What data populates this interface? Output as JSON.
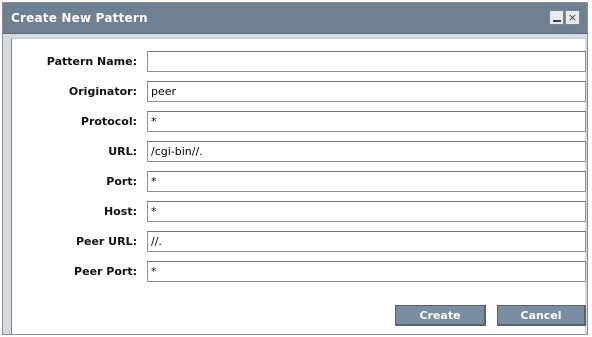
{
  "dialog": {
    "title": "Create New Pattern",
    "minimize_icon": "minimize-icon",
    "close_icon": "close-icon"
  },
  "form": {
    "fields": [
      {
        "label": "Pattern Name:",
        "value": ""
      },
      {
        "label": "Originator:",
        "value": "peer"
      },
      {
        "label": "Protocol:",
        "value": "*"
      },
      {
        "label": "URL:",
        "value": "/cgi-bin//."
      },
      {
        "label": "Port:",
        "value": "*"
      },
      {
        "label": "Host:",
        "value": "*"
      },
      {
        "label": "Peer URL:",
        "value": "//."
      },
      {
        "label": "Peer Port:",
        "value": "*"
      }
    ]
  },
  "buttons": {
    "create_label": "Create",
    "cancel_label": "Cancel"
  }
}
